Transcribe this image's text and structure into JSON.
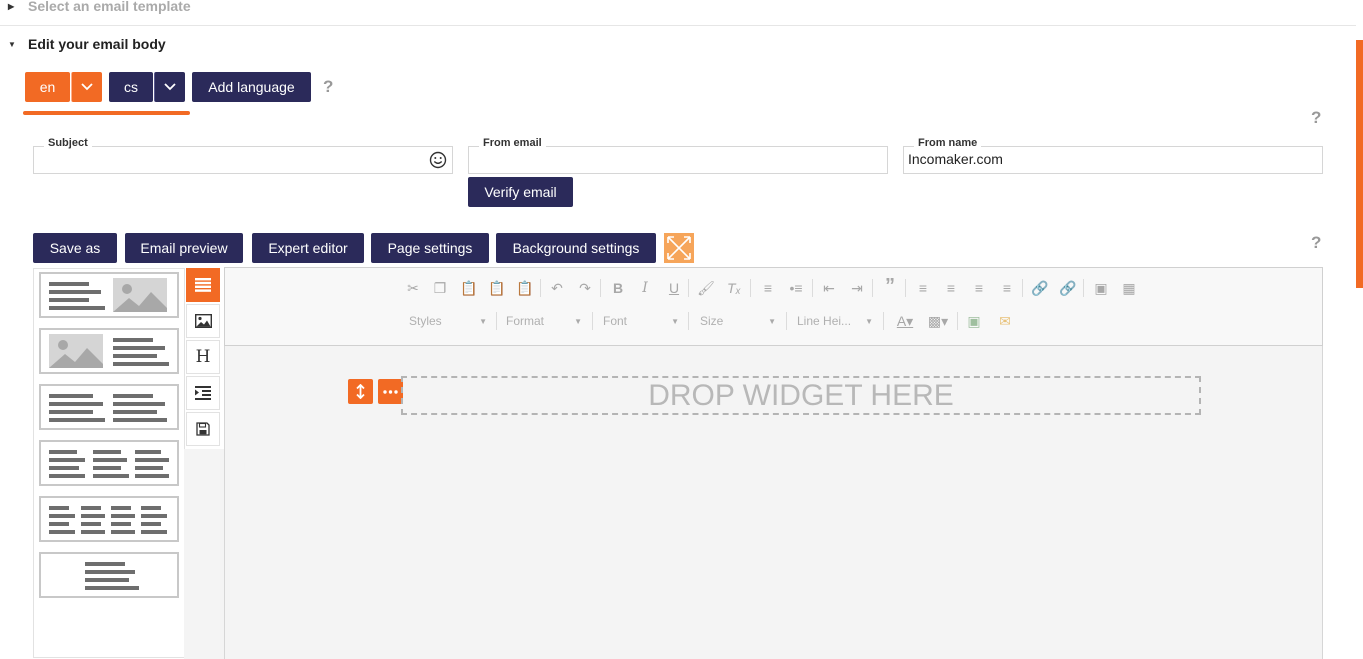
{
  "sections": {
    "template": {
      "title": "Select an email template"
    },
    "body": {
      "title": "Edit your email body"
    }
  },
  "languages": [
    {
      "code": "en",
      "active": true
    },
    {
      "code": "cs",
      "active": false
    }
  ],
  "add_language_label": "Add language",
  "help_glyph": "?",
  "fields": {
    "subject": {
      "label": "Subject",
      "value": ""
    },
    "from_email": {
      "label": "From email",
      "value": ""
    },
    "from_name": {
      "label": "From name",
      "value": "Incomaker.com"
    },
    "verify_label": "Verify email"
  },
  "toolbar": {
    "save_as": "Save as",
    "email_preview": "Email preview",
    "expert_editor": "Expert editor",
    "page_settings": "Page settings",
    "background_settings": "Background settings"
  },
  "editor": {
    "combos": [
      "Styles",
      "Format",
      "Font",
      "Size",
      "Line Hei..."
    ],
    "drop_text": "DROP WIDGET HERE"
  },
  "colors": {
    "navy": "#2b2a5a",
    "orange": "#f26a24",
    "canvas": "#f4f4f4"
  }
}
